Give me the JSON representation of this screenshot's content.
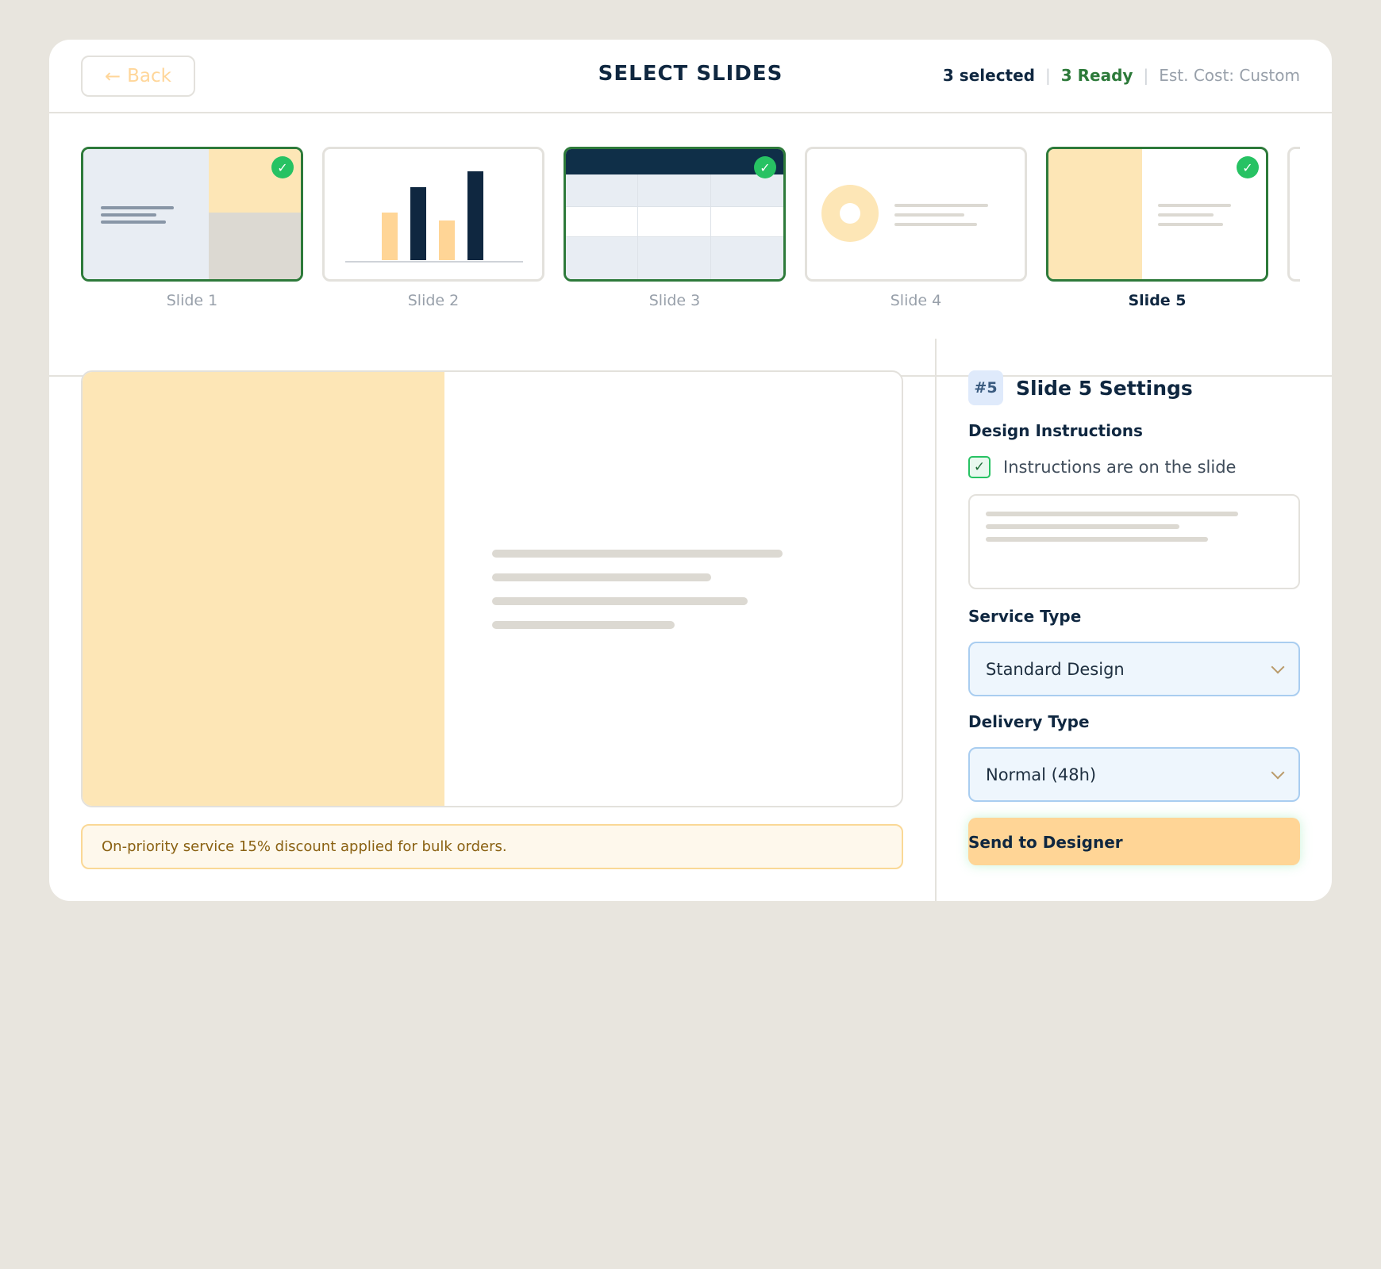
{
  "header": {
    "back_label": "Back",
    "title": "SELECT SLIDES",
    "selected_text": "3 selected",
    "ready_text": "3 Ready",
    "cost_text": "Est. Cost: Custom"
  },
  "slides": [
    {
      "label": "Slide 1",
      "selected": true
    },
    {
      "label": "Slide 2",
      "selected": false
    },
    {
      "label": "Slide 3",
      "selected": true
    },
    {
      "label": "Slide 4",
      "selected": false
    },
    {
      "label": "Slide 5",
      "selected": true,
      "active": true
    }
  ],
  "notice": "On-priority service 15% discount applied for bulk orders.",
  "settings": {
    "badge": "#5",
    "title": "Slide 5 Settings",
    "design_label": "Design Instructions",
    "instructions_checkbox_label": "Instructions are on the slide",
    "instructions_checked": true,
    "service_label": "Service Type",
    "service_value": "Standard Design",
    "delivery_label": "Delivery Type",
    "delivery_value": "Normal (48h)",
    "send_label": "Send to Designer"
  },
  "icons": {
    "back": "arrow-left-icon",
    "selected": "check-circle-icon",
    "checkbox": "checkmark-icon",
    "dropdown": "chevron-down-icon"
  },
  "colors": {
    "accent_green": "#2d7a3a",
    "check_green": "#27c263",
    "peach": "#ffd596",
    "navy": "#0f2740",
    "select_bg": "#eef6fd",
    "select_border": "#a9cdf0"
  }
}
